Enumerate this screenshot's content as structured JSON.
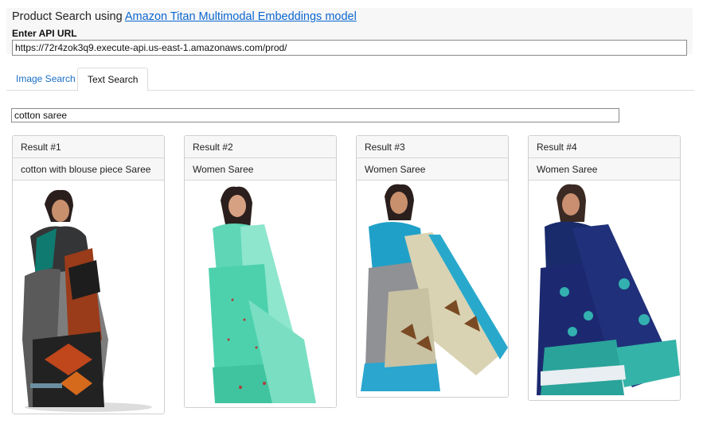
{
  "header": {
    "title_prefix": "Product Search using ",
    "title_link": "Amazon Titan Multimodal Embeddings model",
    "api_label": "Enter API URL",
    "api_url": "https://72r4zok3q9.execute-api.us-east-1.amazonaws.com/prod/"
  },
  "tabs": [
    {
      "label": "Image Search",
      "active": false
    },
    {
      "label": "Text Search",
      "active": true
    }
  ],
  "search": {
    "value": "cotton saree"
  },
  "results": [
    {
      "heading": "Result #1",
      "title": "cotton with blouse piece Saree",
      "image": "saree-product-image"
    },
    {
      "heading": "Result #2",
      "title": "Women Saree",
      "image": "saree-product-image"
    },
    {
      "heading": "Result #3",
      "title": "Women Saree",
      "image": "saree-product-image"
    },
    {
      "heading": "Result #4",
      "title": "Women Saree",
      "image": "saree-product-image"
    }
  ],
  "colors": {
    "link": "#0b66d0",
    "tab_link": "#1a6fc4",
    "panel_bg": "#f7f7f7"
  }
}
